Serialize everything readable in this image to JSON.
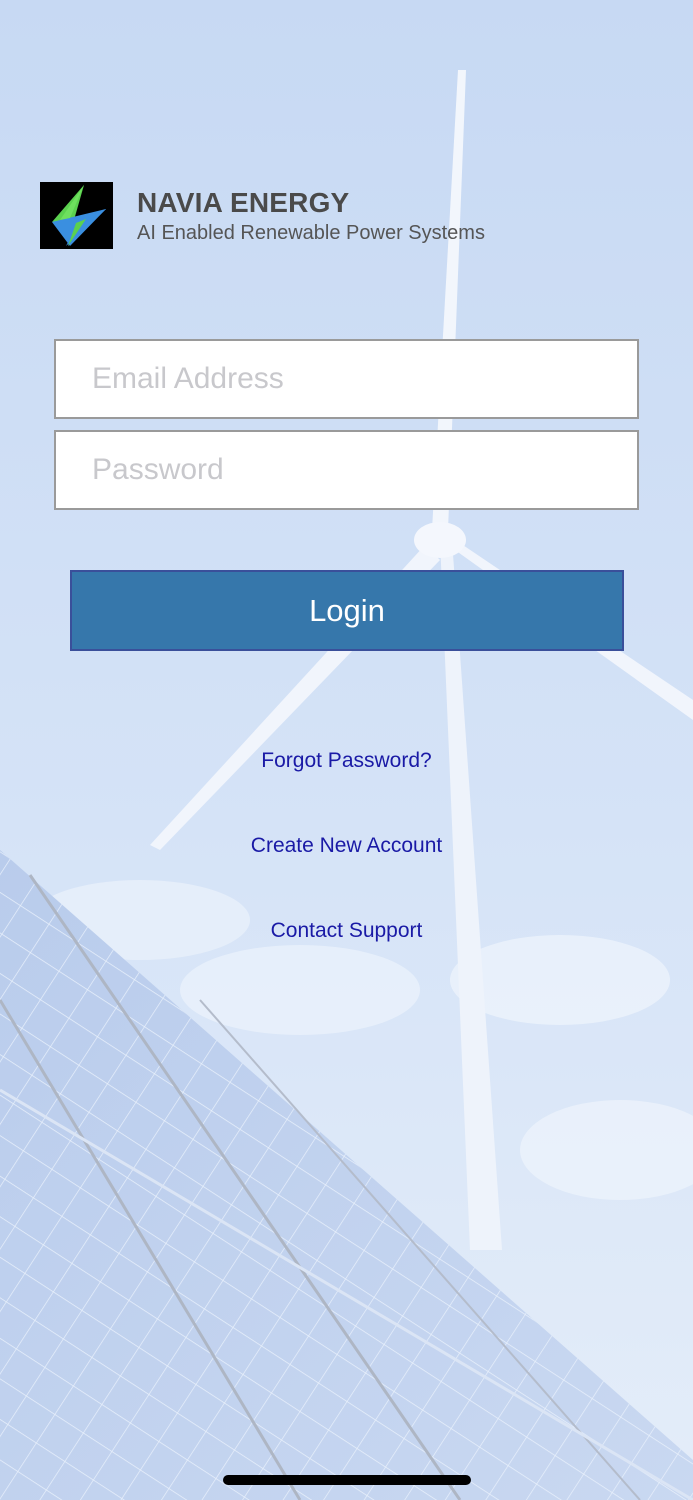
{
  "brand": {
    "name": "NAVIA ENERGY",
    "tagline": "AI Enabled Renewable Power Systems",
    "logo_icon": "lightning-bolt-icon",
    "logo_colors": {
      "background": "#000000",
      "bolt_green": "#5bd14f",
      "bolt_blue": "#3a8fe0"
    }
  },
  "form": {
    "email_placeholder": "Email Address",
    "email_value": "",
    "password_placeholder": "Password",
    "password_value": "",
    "login_label": "Login"
  },
  "links": {
    "forgot_password": "Forgot Password?",
    "create_account": "Create New Account",
    "contact_support": "Contact Support"
  },
  "colors": {
    "login_button": "#3677ab",
    "link": "#1a1aa6",
    "brand_text": "#4a4a4a"
  }
}
